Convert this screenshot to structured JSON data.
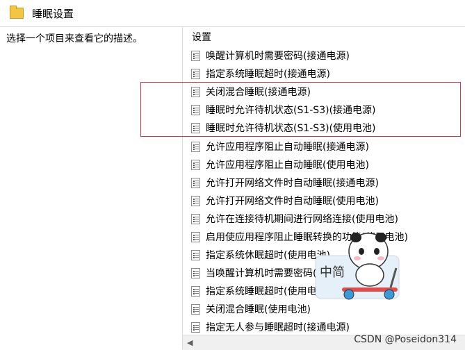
{
  "window": {
    "title": "睡眠设置"
  },
  "left_pane": {
    "description": "选择一个项目来查看它的描述。"
  },
  "right_pane": {
    "column_header": "设置",
    "items": [
      "唤醒计算机时需要密码(接通电源)",
      "指定系统睡眠超时(接通电源)",
      "关闭混合睡眠(接通电源)",
      "睡眠时允许待机状态(S1-S3)(接通电源)",
      "睡眠时允许待机状态(S1-S3)(使用电池)",
      "允许应用程序阻止自动睡眠(接通电源)",
      "允许应用程序阻止自动睡眠(使用电池)",
      "允许打开网络文件时自动睡眠(接通电源)",
      "允许打开网络文件时自动睡眠(使用电池)",
      "允许在连接待机期间进行网络连接(使用电池)",
      "启用使应用程序阻止睡眠转换的功能(使用电池)",
      "指定系统休眠超时(使用电池)",
      "当唤醒计算机时需要密码(使用电池)",
      "指定系统睡眠超时(使用电池)",
      "关闭混合睡眠(使用电池)",
      "指定无人参与睡眠超时(接通电源)"
    ]
  },
  "sticker": {
    "text": "中简",
    "icon": "panda-scooter-sticker"
  },
  "watermark": {
    "text": "CSDN @Poseidon314"
  },
  "colors": {
    "highlight": "#d9363e",
    "folder": "#f4c542"
  }
}
